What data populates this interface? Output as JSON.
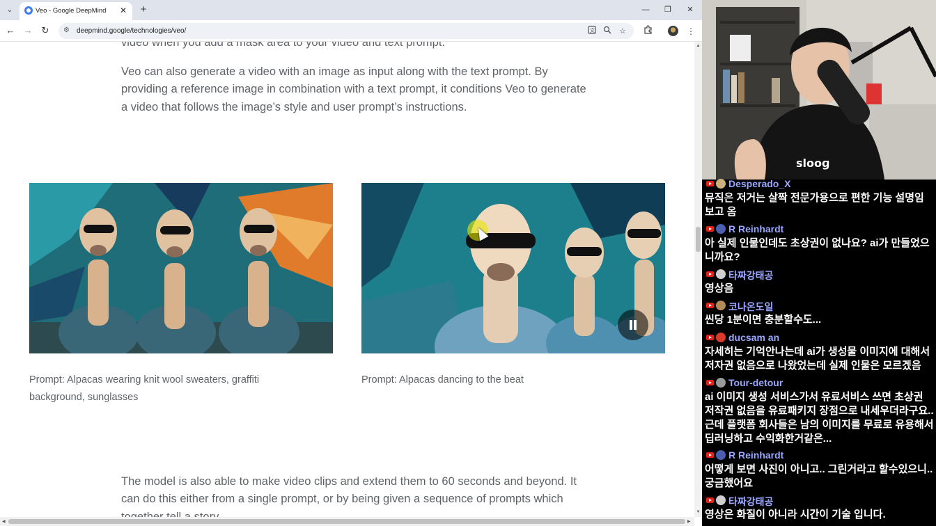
{
  "browser": {
    "tab": {
      "title": "Veo - Google DeepMind",
      "close_glyph": "✕"
    },
    "new_tab_glyph": "+",
    "window_controls": {
      "minimize": "—",
      "restore": "❐",
      "close": "✕"
    },
    "nav": {
      "back": "←",
      "forward": "→",
      "reload": "↻"
    },
    "address": {
      "url": "deepmind.google/technologies/veo/"
    },
    "icons": [
      "translate-icon",
      "zoom-icon",
      "bookmark-star-icon",
      "extensions-icon",
      "profile-avatar",
      "menu-icon"
    ]
  },
  "page": {
    "para_top": "video when you add a mask area to your video and text prompt.",
    "para_1": "Veo can also generate a video with an image as input along with the text prompt. By providing a reference image in combination with a text prompt, it conditions Veo to generate a video that follows the image’s style and user prompt’s instructions.",
    "figures": [
      {
        "caption": "Prompt: Alpacas wearing knit wool sweaters, graffiti background, sunglasses"
      },
      {
        "caption": "Prompt: Alpacas dancing to the beat"
      }
    ],
    "para_2": "The model is also able to make video clips and extend them to 60 seconds and beyond. It can do this either from a single prompt, or by being given a sequence of prompts which together tell a story."
  },
  "chat": {
    "messages": [
      {
        "user": "Desperado_X",
        "user_color": "#9aa7ff",
        "avatar_color": "#c9b37a",
        "text": "뮤직은 저거는 살짝 전문가용으로 편한 기능 설명임 보고 옴"
      },
      {
        "user": "R Reinhardt",
        "user_color": "#9aa7ff",
        "avatar_color": "#4a5fb0",
        "text": "아 실제 인물인데도 초상권이 없나요? ai가 만들었으니까요?"
      },
      {
        "user": "타짜강태공",
        "user_color": "#9aa7ff",
        "avatar_color": "#cfcfcf",
        "text": "영상음"
      },
      {
        "user": "코나온도일",
        "user_color": "#9aa7ff",
        "avatar_color": "#b58a57",
        "text": "씬당 1분이면 충분할수도..."
      },
      {
        "user": "ducsam an",
        "user_color": "#9aa7ff",
        "avatar_color": "#d93a2b",
        "text": "자세히는 기억안나는데 ai가 생성물 이미지에 대해서 저자권 없음으로 나왔었는데 실제 인물은 모르겠음"
      },
      {
        "user": "Tour-detour",
        "user_color": "#9aa7ff",
        "avatar_color": "#9a9a9a",
        "text": "ai 이미지 생성 서비스가서 유료서비스 쓰면 초상권 저작권 없음을 유료패키지 장점으로 내세우더라구요.. 근데 플랫폼 회사들은 남의 이미지를 무료로 유용해서 딥러닝하고 수익화한거같은..."
      },
      {
        "user": "R Reinhardt",
        "user_color": "#9aa7ff",
        "avatar_color": "#4a5fb0",
        "text": "어떻게 보면 사진이 아니고.. 그린거라고 할수있으니.. 궁금했어요"
      },
      {
        "user": "타짜강태공",
        "user_color": "#9aa7ff",
        "avatar_color": "#cfcfcf",
        "text": "영상은 화질이 아니라 시간이 기술 입니다."
      }
    ]
  },
  "colors": {
    "accent": "#3b7cf6",
    "body_text": "#5f6368",
    "chat_name": "#9aa7ff",
    "yt_red": "#e62117"
  }
}
